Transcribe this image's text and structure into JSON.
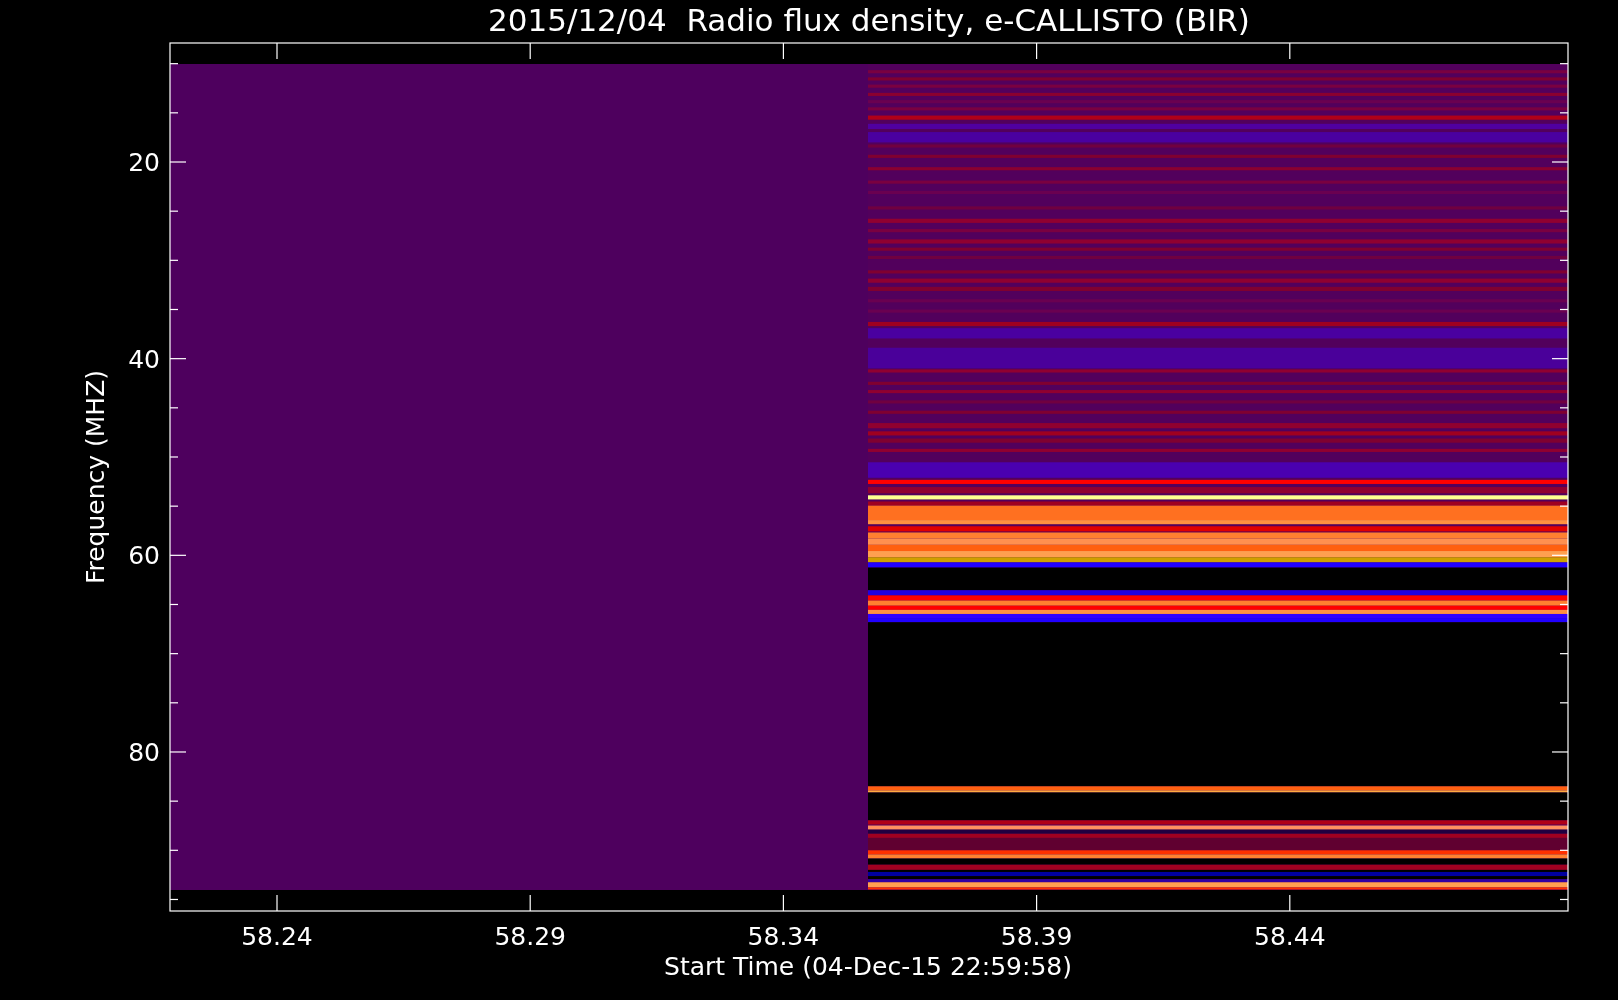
{
  "plot": {
    "title": "2015/12/04  Radio flux density, e-CALLISTO (BIR)",
    "xlabel": "Start Time (04-Dec-15 22:59:58)",
    "ylabel": "Frequency (MHZ)",
    "y_tick_labels": [
      "20",
      "40",
      "60",
      "80"
    ],
    "x_tick_labels": [
      "58.24",
      "58.29",
      "58.34",
      "58.39",
      "58.44"
    ]
  }
}
